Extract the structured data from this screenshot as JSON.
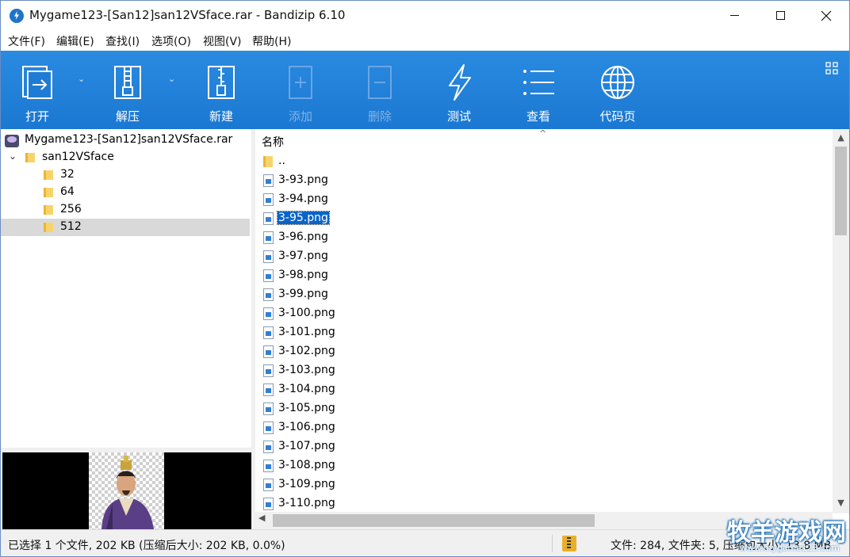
{
  "window": {
    "title": "Mygame123-[San12]san12VSface.rar - Bandizip 6.10"
  },
  "menu": [
    {
      "label": "文件(F)"
    },
    {
      "label": "编辑(E)"
    },
    {
      "label": "查找(I)"
    },
    {
      "label": "选项(O)"
    },
    {
      "label": "视图(V)"
    },
    {
      "label": "帮助(H)"
    }
  ],
  "toolbar": {
    "open": "打开",
    "extract": "解压",
    "new": "新建",
    "add": "添加",
    "delete": "删除",
    "test": "测试",
    "view": "查看",
    "codepage": "代码页"
  },
  "tree": {
    "archive": "Mygame123-[San12]san12VSface.rar",
    "root_folder": "san12VSface",
    "folders": [
      "32",
      "64",
      "256",
      "512"
    ],
    "selected_folder": "512"
  },
  "list": {
    "column_name": "名称",
    "parent": "..",
    "files": [
      "3-93.png",
      "3-94.png",
      "3-95.png",
      "3-96.png",
      "3-97.png",
      "3-98.png",
      "3-99.png",
      "3-100.png",
      "3-101.png",
      "3-102.png",
      "3-103.png",
      "3-104.png",
      "3-105.png",
      "3-106.png",
      "3-107.png",
      "3-108.png",
      "3-109.png",
      "3-110.png"
    ],
    "selected_file": "3-95.png"
  },
  "status": {
    "left": "已选择 1 个文件, 202 KB (压缩后大小: 202 KB, 0.0%)",
    "right": "文件: 284, 文件夹: 5, 压缩包大小: 13.8 MB"
  },
  "watermark": {
    "text": "牧羊游戏网",
    "url": "www.mygame123.com"
  },
  "colors": {
    "toolbar": "#1e7fd9",
    "selection": "#0a64c8",
    "tree_selected": "#d9d9d9"
  }
}
